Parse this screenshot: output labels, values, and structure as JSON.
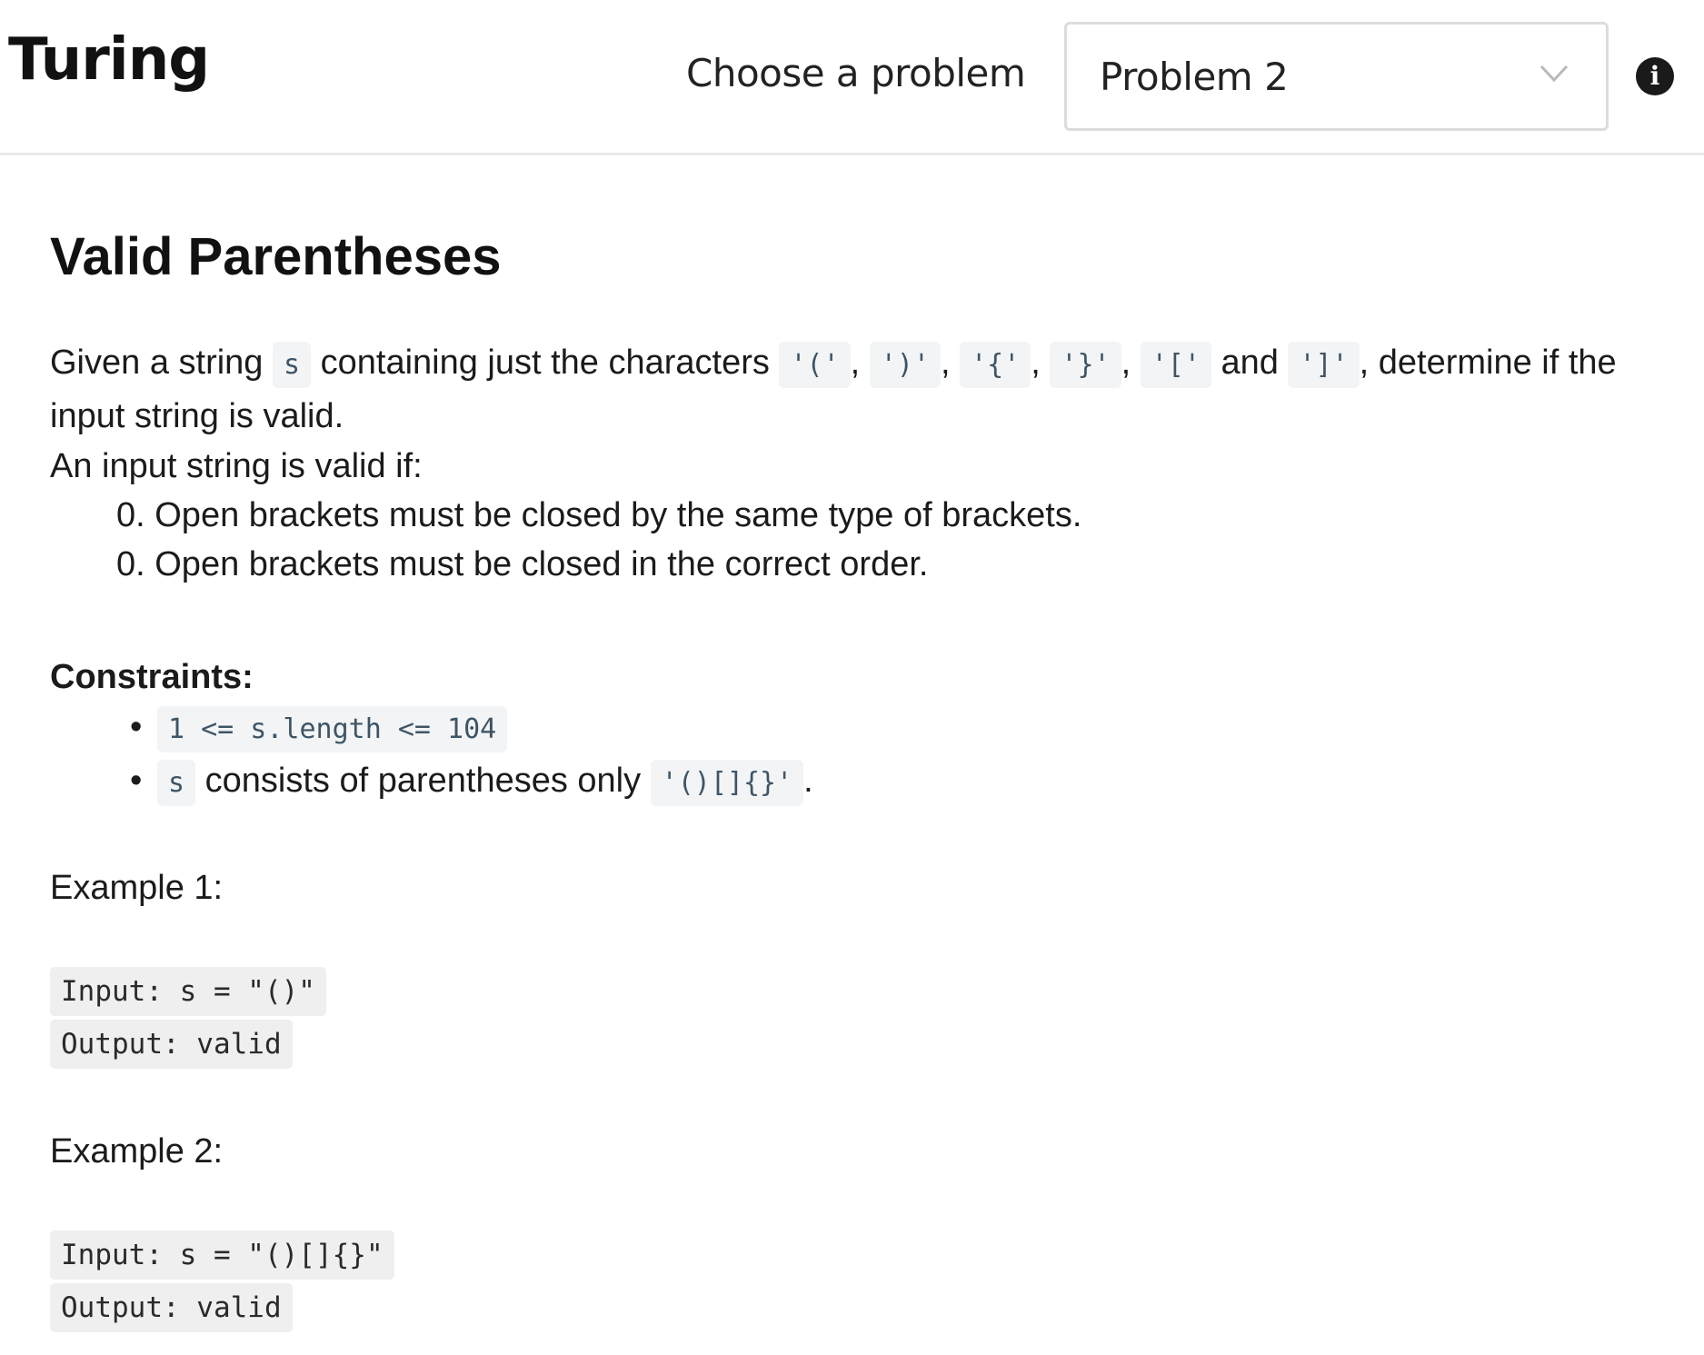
{
  "header": {
    "brand": "Turing",
    "choose_label": "Choose a problem",
    "selected_problem": "Problem 2",
    "info_glyph": "i"
  },
  "problem": {
    "title": "Valid Parentheses",
    "intro": {
      "t1": "Given a string ",
      "c1": "s",
      "t2": " containing just the characters ",
      "c2": "'('",
      "t3": ", ",
      "c3": "')'",
      "t4": ", ",
      "c4": "'{'",
      "t5": ", ",
      "c5": "'}'",
      "t6": ", ",
      "c6": "'['",
      "t7": " and ",
      "c7": "']'",
      "t8": ", determine if the input string is valid."
    },
    "valid_if": "An input string is valid if:",
    "rules": [
      "0. Open brackets must be closed by the same type of brackets.",
      "0. Open brackets must be closed in the correct order."
    ],
    "constraints_title": "Constraints:",
    "constraints": {
      "c1": "1 <= s.length <= 104",
      "c2_code1": "s",
      "c2_text": " consists of parentheses only ",
      "c2_code2": "'()[]{}'",
      "c2_end": "."
    },
    "examples": [
      {
        "title": "Example 1:",
        "input": "Input: s = \"()\"",
        "output": "Output: valid"
      },
      {
        "title": "Example 2:",
        "input": "Input: s = \"()[]{}\"",
        "output": "Output: valid"
      }
    ]
  },
  "colors": {
    "code_bg": "#f2f4f6",
    "code_text": "#3e5566",
    "pre_bg": "#efefef",
    "divider": "#e8e8e8"
  },
  "icons": {
    "dropdown": "chevron-down-icon",
    "info": "info-icon"
  }
}
